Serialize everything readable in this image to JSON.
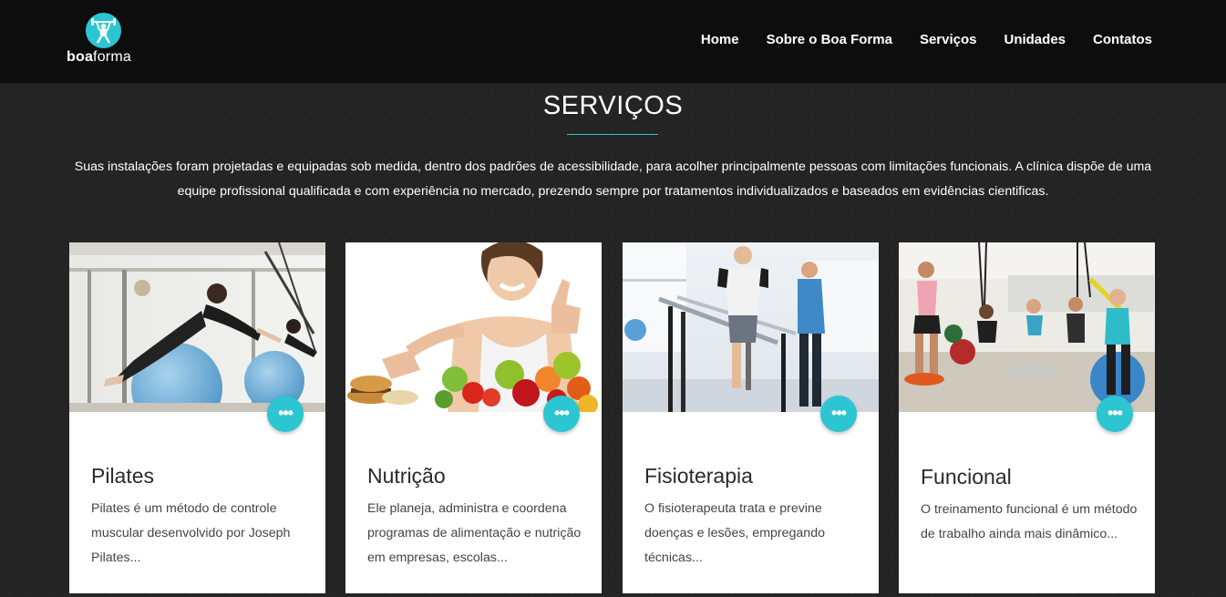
{
  "brand": {
    "name_bold": "boa",
    "name_light": "forma",
    "accent": "#2cc5d2"
  },
  "nav": [
    {
      "label": "Home"
    },
    {
      "label": "Sobre o Boa Forma"
    },
    {
      "label": "Serviços"
    },
    {
      "label": "Unidades"
    },
    {
      "label": "Contatos"
    }
  ],
  "services": {
    "title": "SERVIÇOS",
    "intro": "Suas instalações foram projetadas e equipadas sob medida, dentro dos padrões de acessibilidade, para acolher principalmente pessoas com limitações funcionais. A clínica dispõe de uma equipe profissional qualificada e com experiência no mercado, prezendo sempre por tratamentos individualizados e baseados em evidências cientificas.",
    "cards": [
      {
        "title": "Pilates",
        "text": "Pilates é um método de controle muscular desenvolvido por Joseph Pilates...",
        "image": "pilates-photo",
        "more_icon": "ellipsis-icon"
      },
      {
        "title": "Nutrição",
        "text": "Ele planeja, administra e coordena programas de alimentação e nutrição em empresas, escolas...",
        "image": "nutrition-photo",
        "more_icon": "ellipsis-icon"
      },
      {
        "title": "Fisioterapia",
        "text": "O fisioterapeuta trata e previne doenças e lesões, empregando técnicas...",
        "image": "physiotherapy-photo",
        "more_icon": "ellipsis-icon"
      },
      {
        "title": "Funcional",
        "text": "O treinamento funcional é um método de trabalho ainda mais dinâmico...",
        "image": "functional-training-photo",
        "more_icon": "ellipsis-icon"
      }
    ]
  }
}
